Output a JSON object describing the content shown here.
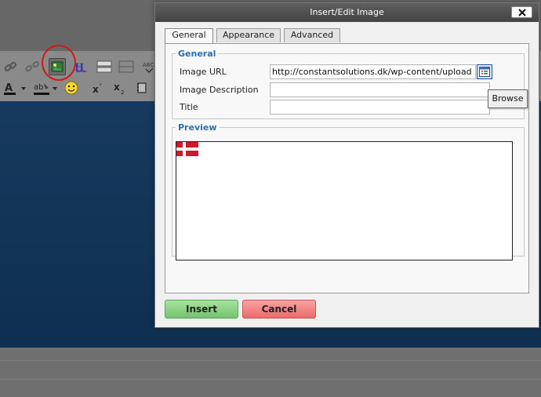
{
  "dialog": {
    "title": "Insert/Edit Image",
    "close_icon": "close-x-icon"
  },
  "tabs": [
    {
      "label": "General",
      "active": true
    },
    {
      "label": "Appearance",
      "active": false
    },
    {
      "label": "Advanced",
      "active": false
    }
  ],
  "general": {
    "legend": "General",
    "image_url_label": "Image URL",
    "image_url_value": "http://constantsolutions.dk/wp-content/upload",
    "image_description_label": "Image Description",
    "image_description_value": "",
    "title_label": "Title",
    "title_value": "",
    "browse_icon": "browse-icon",
    "browse_tooltip": "Browse"
  },
  "preview": {
    "legend": "Preview",
    "image_icon": "danish-flag"
  },
  "buttons": {
    "insert": "Insert",
    "cancel": "Cancel"
  },
  "toolbar_icons": [
    "link-icon",
    "unlink-icon",
    "image-icon",
    "anchor-icon",
    "text-color-icon",
    "highlight-color-icon",
    "emoticon-icon",
    "superscript-icon",
    "subscript-icon",
    "media-icon",
    "table-icon",
    "spellcheck-icon"
  ],
  "colors": {
    "accent": "#2b6fb0",
    "insert": "#7ed376",
    "cancel": "#ef7b7b",
    "highlight_circle": "#d11a1a",
    "flag_red": "#d0182c"
  }
}
